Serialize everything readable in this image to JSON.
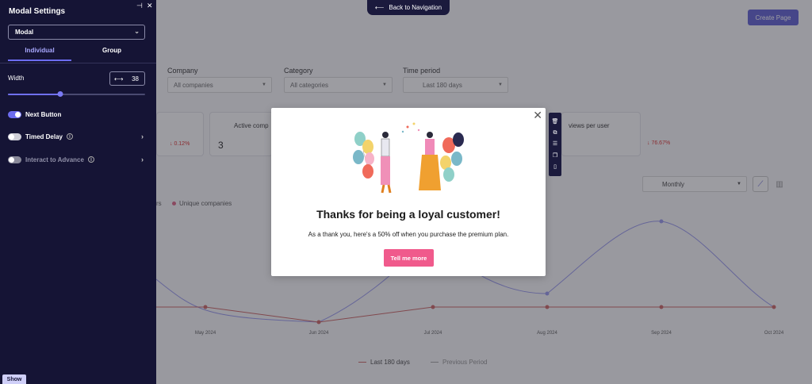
{
  "header": {
    "back_nav_label": "Back to Navigation",
    "create_page_label": "Create Page"
  },
  "filters": {
    "company": {
      "label": "Company",
      "value": "All companies"
    },
    "category": {
      "label": "Category",
      "value": "All categories"
    },
    "time_period": {
      "label": "Time period",
      "value": "Last 180 days"
    }
  },
  "cards": [
    {
      "title": "",
      "value": "",
      "delta": "↓ 0.12%"
    },
    {
      "title": "Active comp",
      "value": "3",
      "delta": ""
    },
    {
      "title": "views per user",
      "value": "",
      "delta": "↓ 76.67%"
    }
  ],
  "chart_controls": {
    "interval": "Monthly"
  },
  "chart_legend": {
    "series_1": "rs",
    "series_2": "Unique companies"
  },
  "chart_data": {
    "type": "line",
    "x": [
      "May 2024",
      "Jun 2024",
      "Jul 2024",
      "Aug 2024",
      "Sep 2024",
      "Oct 2024"
    ],
    "series": [
      {
        "name": "Last 180 days",
        "values": [
          0,
          0,
          0,
          0,
          0,
          0
        ]
      }
    ],
    "legend": [
      "Last 180 days",
      "Previous Period"
    ]
  },
  "sidebar": {
    "title": "Modal Settings",
    "type_select": "Modal",
    "tabs": [
      "Individual",
      "Group"
    ],
    "width_label": "Width",
    "width_value": "38",
    "width_slider_fraction": 0.38,
    "next_button_label": "Next Button",
    "timed_delay_label": "Timed Delay",
    "interact_label": "Interact to Advance",
    "show_label": "Show"
  },
  "modal": {
    "title": "Thanks for being a loyal customer!",
    "body": "As a thank you, here's a 50% off when you purchase the premium plan.",
    "cta": "Tell me more"
  },
  "icons": {
    "back": "arrow-left-icon",
    "close": "close-icon",
    "pin": "pin-icon",
    "resize": "arrows-horizontal-icon"
  },
  "colors": {
    "sidebar_bg": "#151435",
    "accent": "#6c6cf0",
    "cta": "#f05a8c"
  }
}
